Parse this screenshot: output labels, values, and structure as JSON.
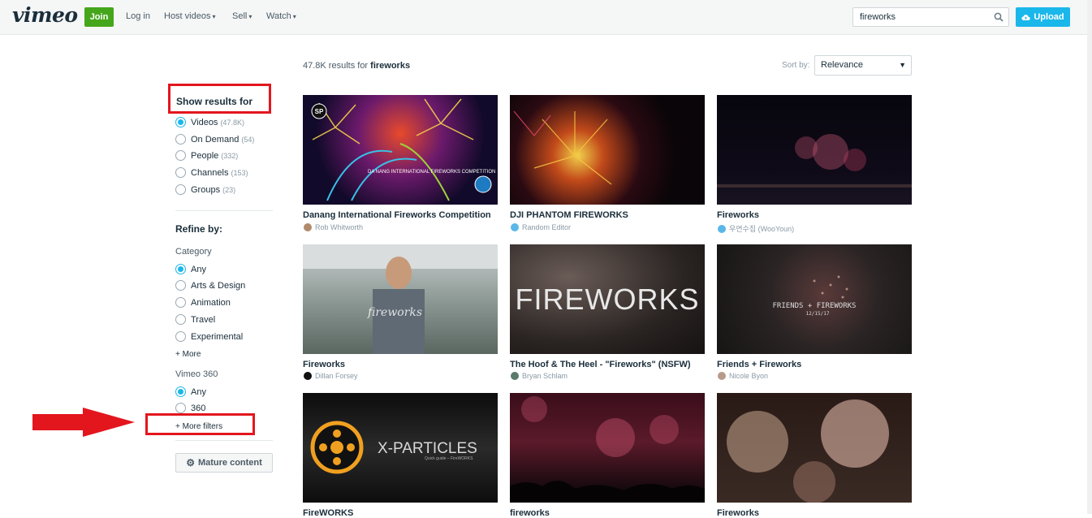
{
  "header": {
    "logo": "vimeo",
    "join_label": "Join",
    "login_label": "Log in",
    "nav": [
      "Host videos",
      "Sell",
      "Watch"
    ],
    "search_value": "fireworks",
    "upload_label": "Upload"
  },
  "sidebar": {
    "show_results_title": "Show results for",
    "types": [
      {
        "label": "Videos",
        "count": "(47.8K)",
        "selected": true
      },
      {
        "label": "On Demand",
        "count": "(54)",
        "selected": false
      },
      {
        "label": "People",
        "count": "(332)",
        "selected": false
      },
      {
        "label": "Channels",
        "count": "(153)",
        "selected": false
      },
      {
        "label": "Groups",
        "count": "(23)",
        "selected": false
      }
    ],
    "refine_title": "Refine by:",
    "category_label": "Category",
    "categories": [
      "Any",
      "Arts & Design",
      "Animation",
      "Travel",
      "Experimental"
    ],
    "more_label": "+ More",
    "vimeo360_label": "Vimeo 360",
    "vimeo360_options": [
      "Any",
      "360"
    ],
    "more_filters_label": "+ More filters",
    "mature_label": "Mature content"
  },
  "results": {
    "count_prefix": "47.8K results for",
    "query": "fireworks",
    "sort_label": "Sort by:",
    "sort_value": "Relevance",
    "videos": [
      {
        "title": "Danang International Fireworks Competition",
        "user": "Rob Whitworth"
      },
      {
        "title": "DJI PHANTOM FIREWORKS",
        "user": "Random Editor"
      },
      {
        "title": "Fireworks",
        "user": "우연수집 (WooYoun)"
      },
      {
        "title": "Fireworks",
        "user": "Dillan Forsey"
      },
      {
        "title": "The Hoof & The Heel - \"Fireworks\" (NSFW)",
        "user": "Bryan Schlam"
      },
      {
        "title": "Friends + Fireworks",
        "user": "Nicole Byon"
      },
      {
        "title": "FireWORKS",
        "user": ""
      },
      {
        "title": "fireworks",
        "user": ""
      },
      {
        "title": "Fireworks",
        "user": ""
      }
    ],
    "thumb_texts": {
      "t1_badge": "SP",
      "t1_caption": "DA NANG INTERNATIONAL FIREWORKS COMPETITION",
      "t5_text": "FIREWORKS",
      "t6_text": "FRIENDS + FIREWORKS",
      "t6_date": "12/15/17",
      "t4_script": "fireworks",
      "t7_text": "X-PARTICLES",
      "t7_sub": "Quick guide – FireWORKS"
    }
  },
  "colors": {
    "brand_green": "#45a61c",
    "brand_blue": "#1ab7ea",
    "annotation_red": "#e3161e"
  }
}
